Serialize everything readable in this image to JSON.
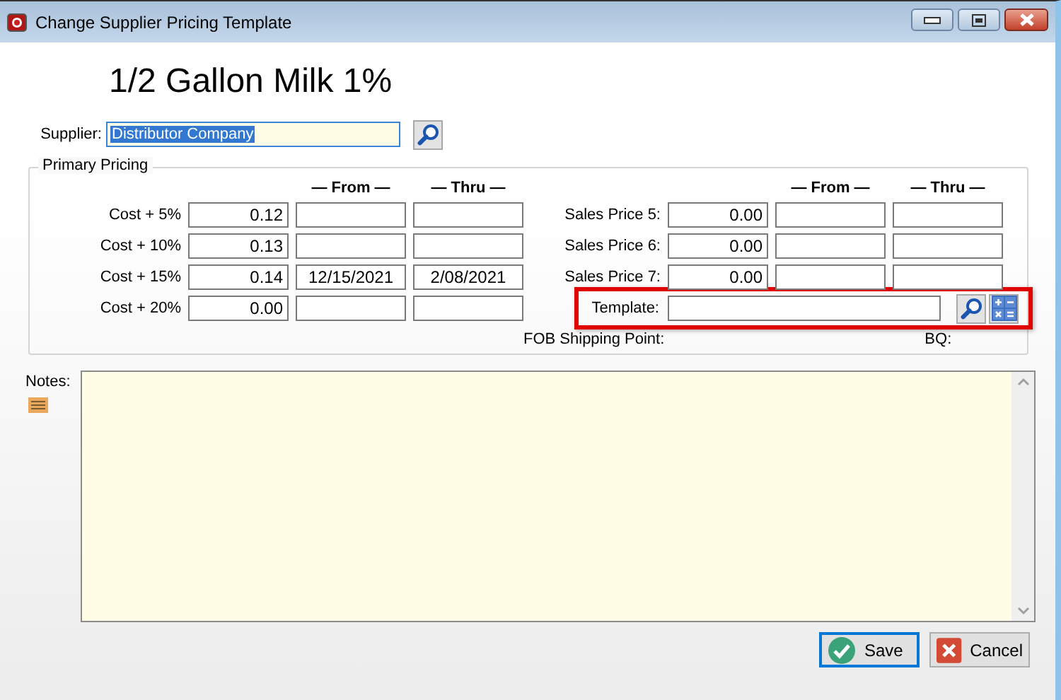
{
  "window": {
    "title": "Change Supplier Pricing Template"
  },
  "heading": "1/2 Gallon Milk 1%",
  "supplier": {
    "label": "Supplier:",
    "value": "Distributor Company",
    "text_selected": true
  },
  "primary_pricing": {
    "title": "Primary Pricing",
    "left": {
      "headers": [
        "— From —",
        "— Thru —"
      ],
      "rows": [
        {
          "label": "Cost + 5%",
          "value": "0.12"
        },
        {
          "label": "Cost + 10%",
          "value": "0.13"
        },
        {
          "label": "Cost + 15%",
          "value": "0.14",
          "from": "12/15/2021",
          "thru": "2/08/2021"
        },
        {
          "label": "Cost + 20%",
          "value": "0.00"
        }
      ]
    },
    "right": {
      "headers": [
        "— From —",
        "— Thru —"
      ],
      "rows": [
        {
          "label": "Sales Price 5:",
          "value": "0.00"
        },
        {
          "label": "Sales Price 6:",
          "value": "0.00"
        },
        {
          "label": "Sales Price 7:",
          "value": "0.00"
        }
      ]
    },
    "template": {
      "label": "Template:",
      "highlighted": true
    },
    "fob_label": "FOB Shipping Point:",
    "bq_label": "BQ:"
  },
  "notes": {
    "label": "Notes:"
  },
  "buttons": [
    {
      "label": "Save",
      "kind": "save",
      "focused": true
    },
    {
      "label": "Cancel",
      "kind": "cancel",
      "focused": false
    }
  ]
}
